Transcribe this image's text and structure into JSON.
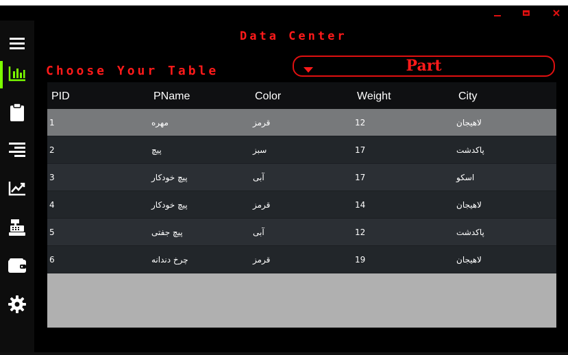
{
  "window": {
    "buttons": [
      {
        "name": "minimize-icon"
      },
      {
        "name": "maximize-icon"
      },
      {
        "name": "close-icon"
      }
    ],
    "accent": "#e01010"
  },
  "sidebar": {
    "active_color": "#7cff00",
    "items": [
      {
        "icon": "menu-icon"
      },
      {
        "icon": "bar-chart-icon",
        "active": true
      },
      {
        "icon": "clipboard-icon"
      },
      {
        "icon": "align-right-icon"
      },
      {
        "icon": "trending-chart-icon"
      },
      {
        "icon": "cash-register-icon"
      },
      {
        "icon": "wallet-icon"
      },
      {
        "icon": "gear-icon"
      }
    ]
  },
  "header": {
    "title": "Data Center",
    "choose_label": "Choose Your Table",
    "dropdown_value": "Part"
  },
  "table": {
    "columns": [
      "PID",
      "PName",
      "Color",
      "Weight",
      "City"
    ],
    "selected_row": 0,
    "rows": [
      [
        "1",
        "مهره",
        "قرمز",
        "12",
        "لاهیجان"
      ],
      [
        "2",
        "پیچ",
        "سبز",
        "17",
        "پاکدشت"
      ],
      [
        "3",
        "پیچ خودکار",
        "آبی",
        "17",
        "اسکو"
      ],
      [
        "4",
        "پیچ خودکار",
        "قرمز",
        "14",
        "لاهیجان"
      ],
      [
        "5",
        "پیچ جفتی",
        "آبی",
        "12",
        "پاکدشت"
      ],
      [
        "6",
        "چرخ دندانه",
        "قرمز",
        "19",
        "لاهیجان"
      ]
    ]
  }
}
